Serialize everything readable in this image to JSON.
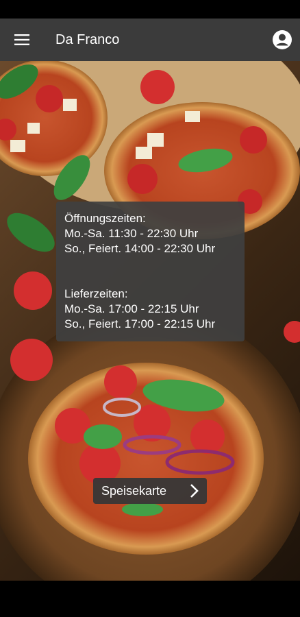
{
  "app_bar": {
    "title": "Da Franco",
    "menu_icon": "hamburger-menu-icon",
    "account_icon": "account-icon"
  },
  "info": {
    "opening_title": "Öffnungszeiten:",
    "opening_weekdays": "Mo.-Sa. 11:30 - 22:30 Uhr",
    "opening_holidays": "So., Feiert. 14:00 - 22:30 Uhr",
    "delivery_title": "Lieferzeiten:",
    "delivery_weekdays": "Mo.-Sa. 17:00 - 22:15 Uhr",
    "delivery_holidays": "So., Feiert. 17:00 - 22:15 Uhr"
  },
  "menu_button": {
    "label": "Speisekarte",
    "icon": "chevron-right-icon"
  },
  "colors": {
    "app_bar": "#3b3b3b",
    "overlay": "#404040"
  }
}
